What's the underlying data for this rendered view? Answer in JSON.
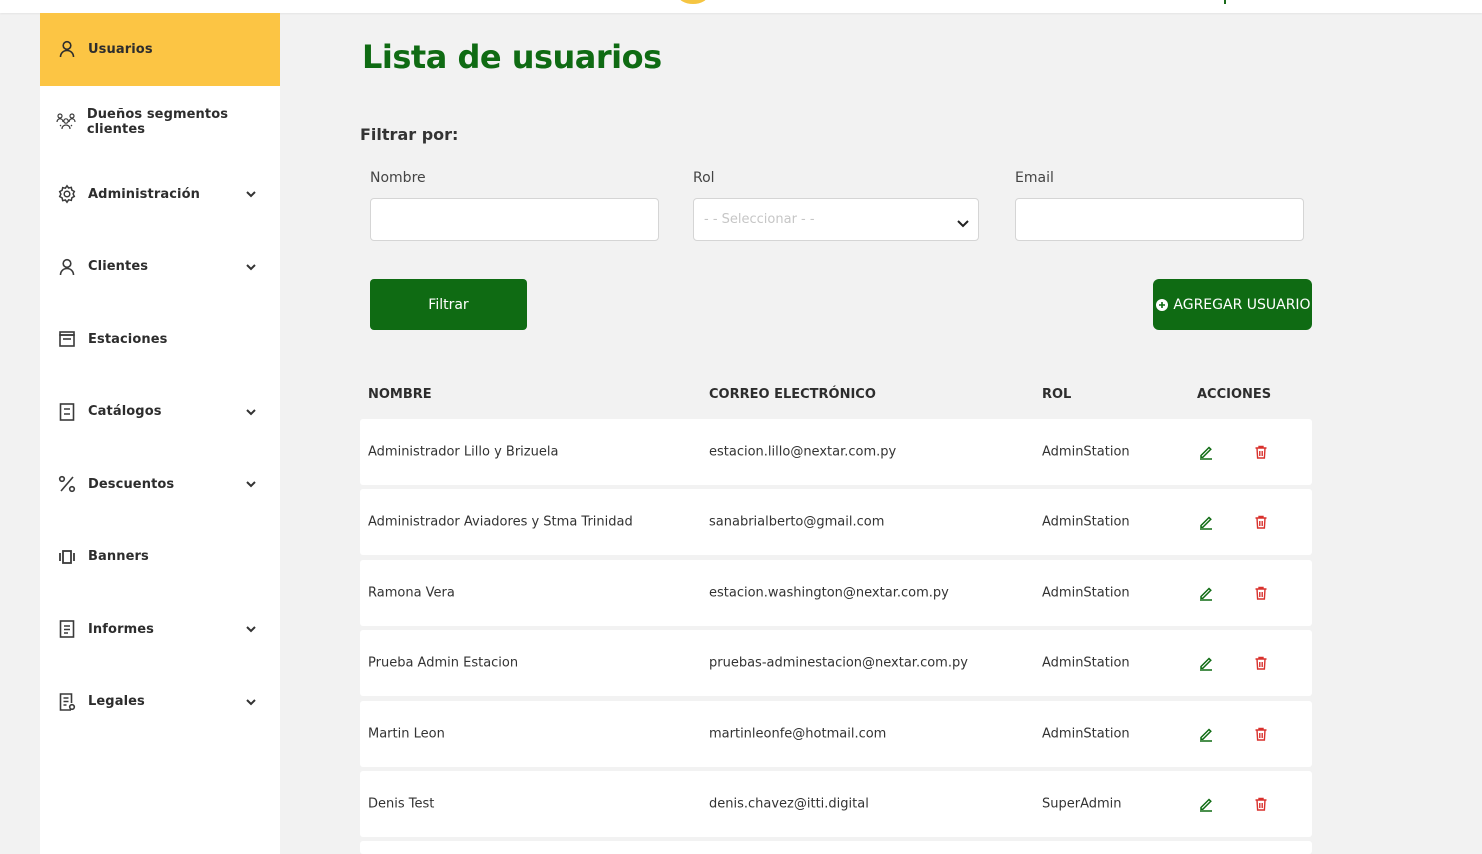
{
  "colors": {
    "brand_green": "#0f6b13",
    "accent_yellow": "#fcc544",
    "delete_red": "#d9302c"
  },
  "sidebar": {
    "items": [
      {
        "label": "Usuarios",
        "icon": "user-icon",
        "active": true,
        "expandable": false
      },
      {
        "label": "Dueños segmentos clientes",
        "icon": "group-icon",
        "active": false,
        "expandable": false
      },
      {
        "label": "Administración",
        "icon": "gear-icon",
        "active": false,
        "expandable": true
      },
      {
        "label": "Clientes",
        "icon": "user-icon",
        "active": false,
        "expandable": true
      },
      {
        "label": "Estaciones",
        "icon": "store-icon",
        "active": false,
        "expandable": false
      },
      {
        "label": "Catálogos",
        "icon": "catalog-icon",
        "active": false,
        "expandable": true
      },
      {
        "label": "Descuentos",
        "icon": "percent-icon",
        "active": false,
        "expandable": true
      },
      {
        "label": "Banners",
        "icon": "carousel-icon",
        "active": false,
        "expandable": false
      },
      {
        "label": "Informes",
        "icon": "document-icon",
        "active": false,
        "expandable": true
      },
      {
        "label": "Legales",
        "icon": "legal-document-icon",
        "active": false,
        "expandable": true
      }
    ]
  },
  "main": {
    "title": "Lista de usuarios",
    "filter_heading": "Filtrar por:",
    "filters": {
      "name_label": "Nombre",
      "name_value": "",
      "role_label": "Rol",
      "role_placeholder": "- - Seleccionar - -",
      "email_label": "Email",
      "email_value": ""
    },
    "filter_button": "Filtrar",
    "add_button": "AGREGAR USUARIO",
    "table": {
      "headers": [
        "NOMBRE",
        "CORREO ELECTRÓNICO",
        "ROL",
        "ACCIONES"
      ],
      "rows": [
        {
          "name": "Administrador Lillo y Brizuela",
          "email": "estacion.lillo@nextar.com.py",
          "role": "AdminStation"
        },
        {
          "name": "Administrador Aviadores y Stma Trinidad",
          "email": "sanabrialberto@gmail.com",
          "role": "AdminStation"
        },
        {
          "name": "Ramona Vera",
          "email": "estacion.washington@nextar.com.py",
          "role": "AdminStation"
        },
        {
          "name": "Prueba Admin Estacion",
          "email": "pruebas-adminestacion@nextar.com.py",
          "role": "AdminStation"
        },
        {
          "name": "Martin Leon",
          "email": "martinleonfe@hotmail.com",
          "role": "AdminStation"
        },
        {
          "name": "Denis Test",
          "email": "denis.chavez@itti.digital",
          "role": "SuperAdmin"
        }
      ]
    }
  }
}
